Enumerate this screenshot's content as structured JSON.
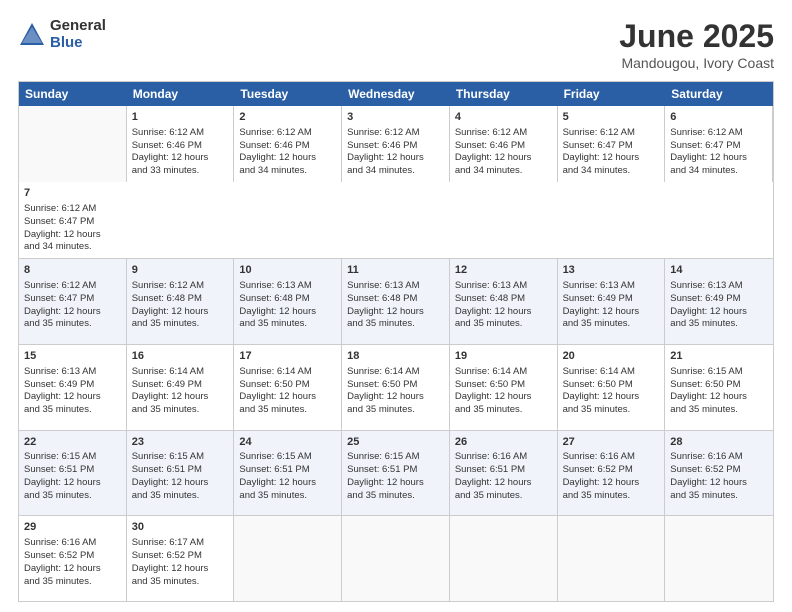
{
  "logo": {
    "general": "General",
    "blue": "Blue"
  },
  "title": "June 2025",
  "subtitle": "Mandougou, Ivory Coast",
  "header_days": [
    "Sunday",
    "Monday",
    "Tuesday",
    "Wednesday",
    "Thursday",
    "Friday",
    "Saturday"
  ],
  "rows": [
    [
      {
        "day": "",
        "empty": true
      },
      {
        "day": "1",
        "line1": "Sunrise: 6:12 AM",
        "line2": "Sunset: 6:46 PM",
        "line3": "Daylight: 12 hours",
        "line4": "and 33 minutes."
      },
      {
        "day": "2",
        "line1": "Sunrise: 6:12 AM",
        "line2": "Sunset: 6:46 PM",
        "line3": "Daylight: 12 hours",
        "line4": "and 34 minutes."
      },
      {
        "day": "3",
        "line1": "Sunrise: 6:12 AM",
        "line2": "Sunset: 6:46 PM",
        "line3": "Daylight: 12 hours",
        "line4": "and 34 minutes."
      },
      {
        "day": "4",
        "line1": "Sunrise: 6:12 AM",
        "line2": "Sunset: 6:46 PM",
        "line3": "Daylight: 12 hours",
        "line4": "and 34 minutes."
      },
      {
        "day": "5",
        "line1": "Sunrise: 6:12 AM",
        "line2": "Sunset: 6:47 PM",
        "line3": "Daylight: 12 hours",
        "line4": "and 34 minutes."
      },
      {
        "day": "6",
        "line1": "Sunrise: 6:12 AM",
        "line2": "Sunset: 6:47 PM",
        "line3": "Daylight: 12 hours",
        "line4": "and 34 minutes."
      },
      {
        "day": "7",
        "line1": "Sunrise: 6:12 AM",
        "line2": "Sunset: 6:47 PM",
        "line3": "Daylight: 12 hours",
        "line4": "and 34 minutes."
      }
    ],
    [
      {
        "day": "8",
        "line1": "Sunrise: 6:12 AM",
        "line2": "Sunset: 6:47 PM",
        "line3": "Daylight: 12 hours",
        "line4": "and 35 minutes."
      },
      {
        "day": "9",
        "line1": "Sunrise: 6:12 AM",
        "line2": "Sunset: 6:48 PM",
        "line3": "Daylight: 12 hours",
        "line4": "and 35 minutes."
      },
      {
        "day": "10",
        "line1": "Sunrise: 6:13 AM",
        "line2": "Sunset: 6:48 PM",
        "line3": "Daylight: 12 hours",
        "line4": "and 35 minutes."
      },
      {
        "day": "11",
        "line1": "Sunrise: 6:13 AM",
        "line2": "Sunset: 6:48 PM",
        "line3": "Daylight: 12 hours",
        "line4": "and 35 minutes."
      },
      {
        "day": "12",
        "line1": "Sunrise: 6:13 AM",
        "line2": "Sunset: 6:48 PM",
        "line3": "Daylight: 12 hours",
        "line4": "and 35 minutes."
      },
      {
        "day": "13",
        "line1": "Sunrise: 6:13 AM",
        "line2": "Sunset: 6:49 PM",
        "line3": "Daylight: 12 hours",
        "line4": "and 35 minutes."
      },
      {
        "day": "14",
        "line1": "Sunrise: 6:13 AM",
        "line2": "Sunset: 6:49 PM",
        "line3": "Daylight: 12 hours",
        "line4": "and 35 minutes."
      }
    ],
    [
      {
        "day": "15",
        "line1": "Sunrise: 6:13 AM",
        "line2": "Sunset: 6:49 PM",
        "line3": "Daylight: 12 hours",
        "line4": "and 35 minutes."
      },
      {
        "day": "16",
        "line1": "Sunrise: 6:14 AM",
        "line2": "Sunset: 6:49 PM",
        "line3": "Daylight: 12 hours",
        "line4": "and 35 minutes."
      },
      {
        "day": "17",
        "line1": "Sunrise: 6:14 AM",
        "line2": "Sunset: 6:50 PM",
        "line3": "Daylight: 12 hours",
        "line4": "and 35 minutes."
      },
      {
        "day": "18",
        "line1": "Sunrise: 6:14 AM",
        "line2": "Sunset: 6:50 PM",
        "line3": "Daylight: 12 hours",
        "line4": "and 35 minutes."
      },
      {
        "day": "19",
        "line1": "Sunrise: 6:14 AM",
        "line2": "Sunset: 6:50 PM",
        "line3": "Daylight: 12 hours",
        "line4": "and 35 minutes."
      },
      {
        "day": "20",
        "line1": "Sunrise: 6:14 AM",
        "line2": "Sunset: 6:50 PM",
        "line3": "Daylight: 12 hours",
        "line4": "and 35 minutes."
      },
      {
        "day": "21",
        "line1": "Sunrise: 6:15 AM",
        "line2": "Sunset: 6:50 PM",
        "line3": "Daylight: 12 hours",
        "line4": "and 35 minutes."
      }
    ],
    [
      {
        "day": "22",
        "line1": "Sunrise: 6:15 AM",
        "line2": "Sunset: 6:51 PM",
        "line3": "Daylight: 12 hours",
        "line4": "and 35 minutes."
      },
      {
        "day": "23",
        "line1": "Sunrise: 6:15 AM",
        "line2": "Sunset: 6:51 PM",
        "line3": "Daylight: 12 hours",
        "line4": "and 35 minutes."
      },
      {
        "day": "24",
        "line1": "Sunrise: 6:15 AM",
        "line2": "Sunset: 6:51 PM",
        "line3": "Daylight: 12 hours",
        "line4": "and 35 minutes."
      },
      {
        "day": "25",
        "line1": "Sunrise: 6:15 AM",
        "line2": "Sunset: 6:51 PM",
        "line3": "Daylight: 12 hours",
        "line4": "and 35 minutes."
      },
      {
        "day": "26",
        "line1": "Sunrise: 6:16 AM",
        "line2": "Sunset: 6:51 PM",
        "line3": "Daylight: 12 hours",
        "line4": "and 35 minutes."
      },
      {
        "day": "27",
        "line1": "Sunrise: 6:16 AM",
        "line2": "Sunset: 6:52 PM",
        "line3": "Daylight: 12 hours",
        "line4": "and 35 minutes."
      },
      {
        "day": "28",
        "line1": "Sunrise: 6:16 AM",
        "line2": "Sunset: 6:52 PM",
        "line3": "Daylight: 12 hours",
        "line4": "and 35 minutes."
      }
    ],
    [
      {
        "day": "29",
        "line1": "Sunrise: 6:16 AM",
        "line2": "Sunset: 6:52 PM",
        "line3": "Daylight: 12 hours",
        "line4": "and 35 minutes."
      },
      {
        "day": "30",
        "line1": "Sunrise: 6:17 AM",
        "line2": "Sunset: 6:52 PM",
        "line3": "Daylight: 12 hours",
        "line4": "and 35 minutes."
      },
      {
        "day": "",
        "empty": true
      },
      {
        "day": "",
        "empty": true
      },
      {
        "day": "",
        "empty": true
      },
      {
        "day": "",
        "empty": true
      },
      {
        "day": "",
        "empty": true
      }
    ]
  ]
}
